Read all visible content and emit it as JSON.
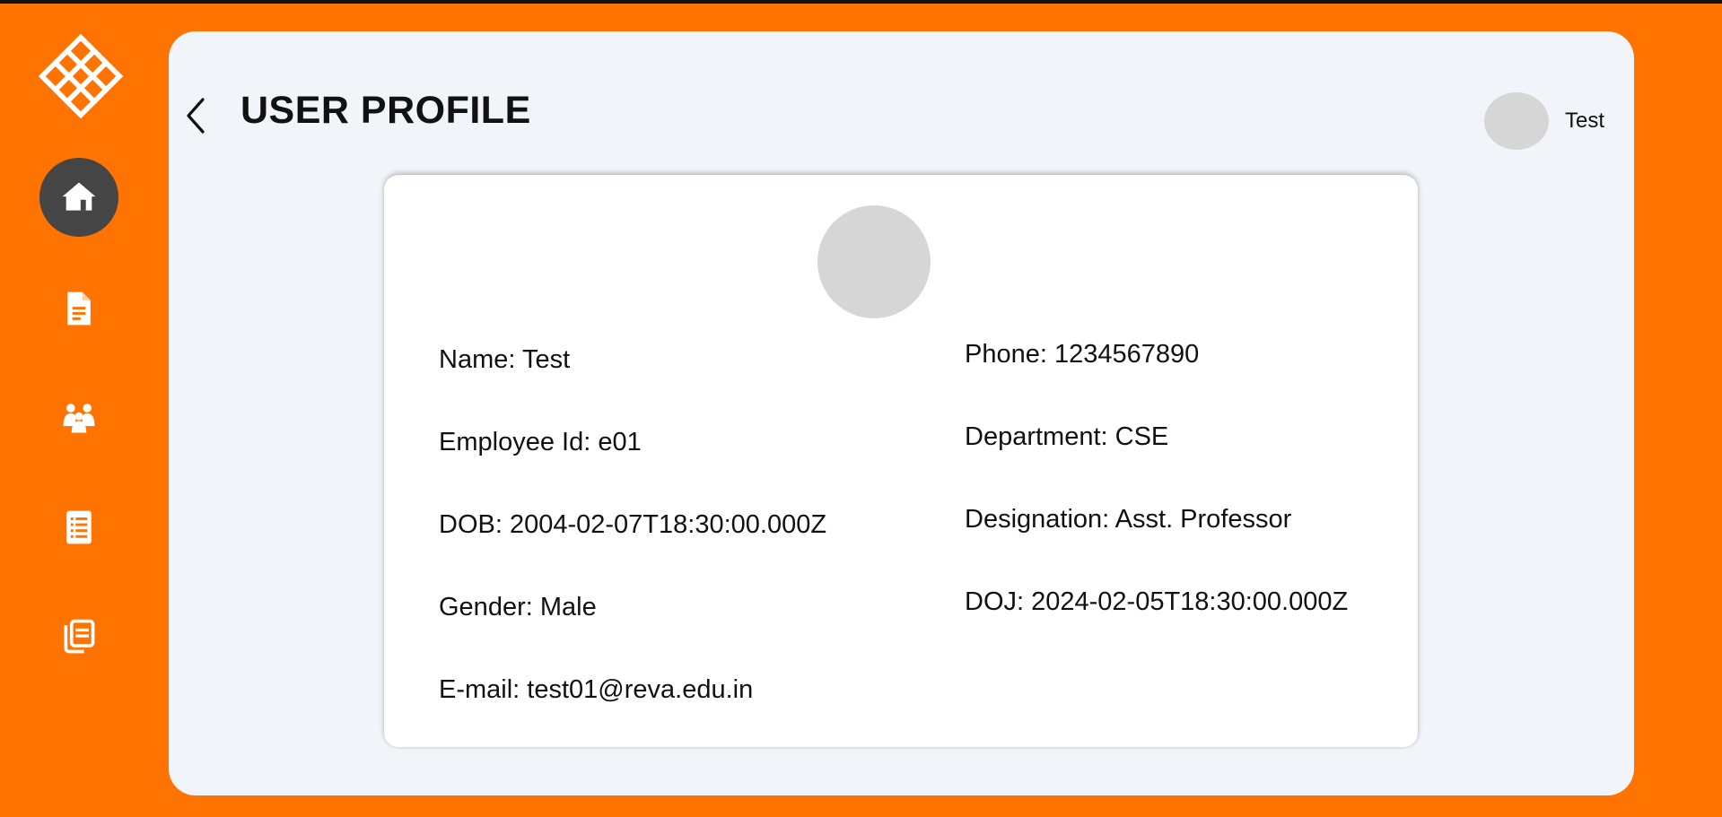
{
  "header": {
    "title": "USER PROFILE",
    "username": "Test"
  },
  "sidebar": {
    "items": [
      {
        "icon": "home-icon",
        "active": true
      },
      {
        "icon": "document-icon",
        "active": false
      },
      {
        "icon": "users-icon",
        "active": false
      },
      {
        "icon": "list-icon",
        "active": false
      },
      {
        "icon": "copy-icon",
        "active": false
      }
    ]
  },
  "profile": {
    "left": [
      "Name: Test",
      "Employee Id: e01",
      "DOB: 2004-02-07T18:30:00.000Z",
      "Gender: Male",
      "E-mail: test01@reva.edu.in"
    ],
    "right": [
      "Phone: 1234567890",
      "Department: CSE",
      "Designation: Asst. Professor",
      "DOJ: 2024-02-05T18:30:00.000Z"
    ]
  },
  "colors": {
    "brand": "#ff7300",
    "panel": "#f1f4f9",
    "active_nav": "#454545",
    "avatar_placeholder": "#d6d6d6"
  }
}
